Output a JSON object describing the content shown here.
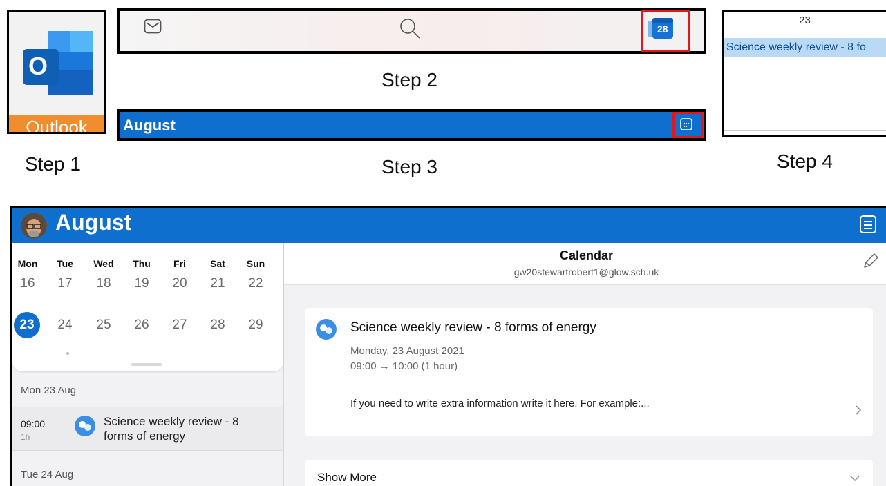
{
  "steps": {
    "step1": "Step 1",
    "step2": "Step 2",
    "step3": "Step 3",
    "step4": "Step 4"
  },
  "step1_app": {
    "name": "Outlook",
    "logo_letter": "O",
    "icon": "outlook-logo-icon"
  },
  "step2_bar": {
    "icons": [
      "mail-icon",
      "search-icon",
      "calendar-icon"
    ],
    "calendar_date": "28"
  },
  "step3_bar": {
    "title": "August",
    "icon": "calendar-grid-icon"
  },
  "step4_preview": {
    "day": "23",
    "event": "Science weekly review - 8 fo"
  },
  "app": {
    "title": "August",
    "weekdays": [
      "Mon",
      "Tue",
      "Wed",
      "Thu",
      "Fri",
      "Sat",
      "Sun"
    ],
    "week1": [
      "16",
      "17",
      "18",
      "19",
      "20",
      "21",
      "22"
    ],
    "week2": [
      "23",
      "24",
      "25",
      "26",
      "27",
      "28",
      "29"
    ],
    "selected_day": "23",
    "agenda": {
      "day1_header": "Mon 23 Aug",
      "item_time": "09:00",
      "item_duration": "1h",
      "item_title": "Science weekly review - 8 forms of energy",
      "day2_header": "Tue 24 Aug"
    },
    "detail": {
      "calendar_name": "Calendar",
      "calendar_email": "gw20stewartrobert1@glow.sch.uk",
      "event_title": "Science weekly review - 8 forms of energy",
      "event_date": "Monday, 23 August 2021",
      "event_time": "09:00 → 10:00 (1 hour)",
      "event_note": "If you need to write extra information write it here.  For example:...",
      "show_more": "Show More"
    }
  },
  "colors": {
    "brand_blue": "#0f6fce",
    "highlight_red": "#e3161d",
    "event_icon_blue": "#3a8ee6"
  }
}
